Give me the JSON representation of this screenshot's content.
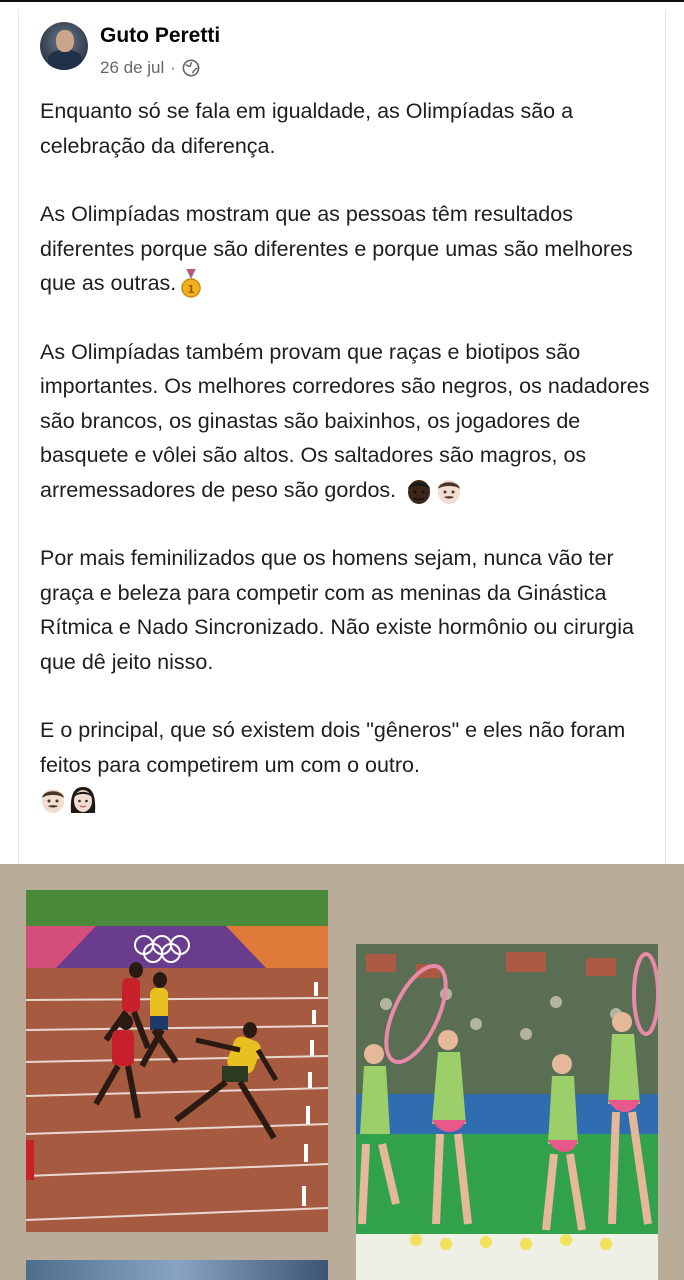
{
  "post": {
    "author": "Guto Peretti",
    "date": "26 de jul",
    "separator": "·",
    "privacy_icon": "globe-icon",
    "paragraphs": [
      "Enquanto só se fala em igualdade, as Olimpíadas são a celebração da diferença.",
      "As Olimpíadas mostram que as pessoas têm resultados diferentes porque são diferentes e porque umas são melhores que as outras.",
      "As Olimpíadas também provam que raças e biotipos são importantes. Os melhores corredores são negros, os nadadores são brancos, os ginastas são baixinhos, os jogadores de basquete e vôlei são altos. Os saltadores são magros, os arremessadores de peso são gordos.",
      "Por mais feminilizados que os homens sejam, nunca vão ter graça e beleza para competir com as meninas da Ginástica Rítmica e Nado Sincronizado. Não existe hormônio ou cirurgia que dê jeito nisso.",
      "E o principal, que só existem dois \"gêneros\" e eles não foram feitos para competirem um com o outro."
    ]
  },
  "emoji_names": [
    "gold-medal-emoji",
    "dark-skin-man-emoji",
    "light-skin-man-emoji",
    "light-skin-woman-emoji"
  ],
  "photos": {
    "left": "sprinters-photo",
    "right": "rhythmic-gymnasts-photo",
    "left_bottom": "swimming-photo"
  },
  "colors": {
    "text": "#1c1e21",
    "meta": "#65676b",
    "photo_background": "#b9ad9a",
    "track": "#a0563f"
  }
}
